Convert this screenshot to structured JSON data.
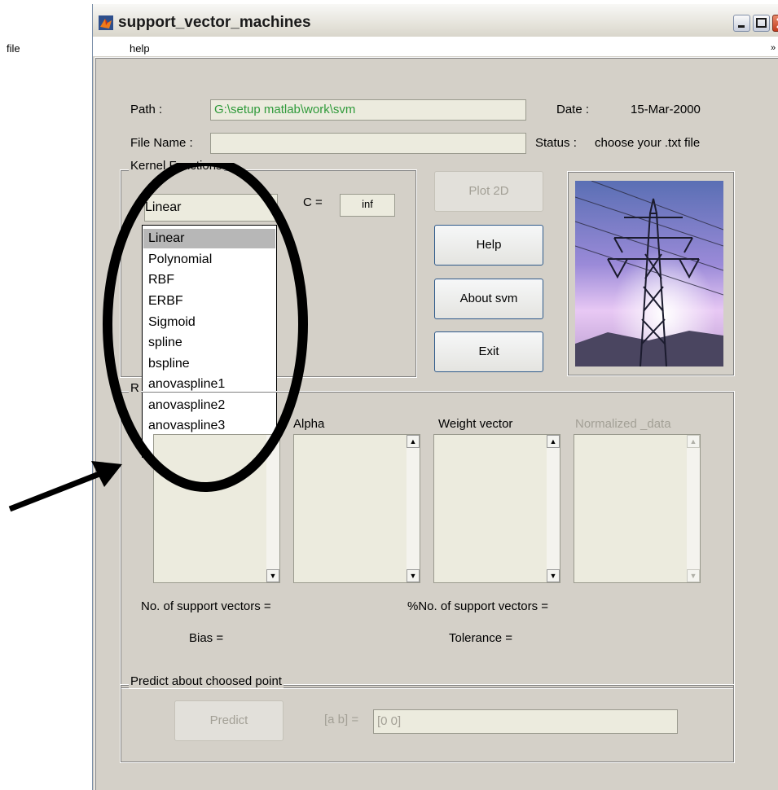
{
  "window": {
    "title": "support_vector_machines"
  },
  "menu": {
    "file": "file",
    "help": "help",
    "overflow_arrow": "»"
  },
  "fields": {
    "path_label": "Path :",
    "path_value": "G:\\setup matlab\\work\\svm",
    "date_label": "Date :",
    "date_value": "15-Mar-2000",
    "filename_label": "File Name :",
    "filename_value": "",
    "status_label": "Status :",
    "status_value": "choose your .txt file"
  },
  "kernel": {
    "panel_title": "Kernel Functions",
    "selected": "Linear",
    "options": [
      "Linear",
      "Polynomial",
      "RBF",
      "ERBF",
      "Sigmoid",
      "spline",
      "bspline",
      "anovaspline1",
      "anovaspline2",
      "anovaspline3"
    ],
    "c_label": "C =",
    "c_value": "inf"
  },
  "buttons": {
    "plot2d": "Plot 2D",
    "help": "Help",
    "about": "About svm",
    "exit": "Exit",
    "predict": "Predict"
  },
  "results": {
    "panel_title": "R",
    "alpha_label": "Alpha",
    "weight_label": "Weight vector",
    "normalized_label": "Normalized _data",
    "nsv_label": "No. of support vectors =",
    "pct_nsv_label": "%No. of support vectors =",
    "bias_label": "Bias =",
    "tolerance_label": "Tolerance ="
  },
  "predict": {
    "panel_title": "Predict about choosed point",
    "point_label": "[a   b]  =",
    "point_value": "[0 0]"
  },
  "colors": {
    "path_text": "#2f9a3a",
    "disabled_text": "#a3a096",
    "annotation": "#000000"
  }
}
